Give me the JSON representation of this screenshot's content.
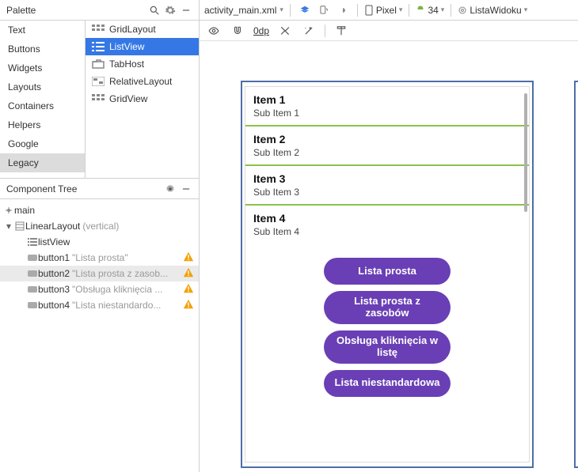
{
  "palette": {
    "title": "Palette",
    "categories": [
      "Text",
      "Buttons",
      "Widgets",
      "Layouts",
      "Containers",
      "Helpers",
      "Google",
      "Legacy"
    ],
    "selected_category": "Legacy",
    "widgets": [
      {
        "label": "GridLayout",
        "icon": "grid-icon"
      },
      {
        "label": "ListView",
        "icon": "list-icon",
        "selected": true
      },
      {
        "label": "TabHost",
        "icon": "tab-icon"
      },
      {
        "label": "RelativeLayout",
        "icon": "layout-icon"
      },
      {
        "label": "GridView",
        "icon": "grid-icon"
      }
    ]
  },
  "tree": {
    "title": "Component Tree",
    "rows": [
      {
        "depth": 0,
        "twisty": "down",
        "icon": "root",
        "label": "main"
      },
      {
        "depth": 1,
        "twisty": "down",
        "icon": "layout",
        "label": "LinearLayout",
        "suffix": "(vertical)"
      },
      {
        "depth": 2,
        "icon": "list",
        "label": "listView"
      },
      {
        "depth": 2,
        "icon": "button",
        "label": "button1",
        "suffix": "\"Lista prosta\"",
        "warn": true
      },
      {
        "depth": 2,
        "icon": "button",
        "label": "button2",
        "suffix": "\"Lista prosta z zasob...",
        "warn": true,
        "selected": true
      },
      {
        "depth": 2,
        "icon": "button",
        "label": "button3",
        "suffix": "\"Obsługa kliknięcia ...",
        "warn": true
      },
      {
        "depth": 2,
        "icon": "button",
        "label": "button4",
        "suffix": "\"Lista niestandardo...",
        "warn": true
      }
    ]
  },
  "toolbar": {
    "file": "activity_main.xml",
    "device": "Pixel",
    "api": "34",
    "module": "ListaWidoku",
    "dp_label": "0dp"
  },
  "preview": {
    "list": [
      {
        "title": "Item 1",
        "sub": "Sub Item 1"
      },
      {
        "title": "Item 2",
        "sub": "Sub Item 2"
      },
      {
        "title": "Item 3",
        "sub": "Sub Item 3"
      },
      {
        "title": "Item 4",
        "sub": "Sub Item 4"
      }
    ],
    "buttons": [
      "Lista prosta",
      "Lista prosta z zasobów",
      "Obsługa kliknięcia w listę",
      "Lista niestandardowa"
    ]
  }
}
